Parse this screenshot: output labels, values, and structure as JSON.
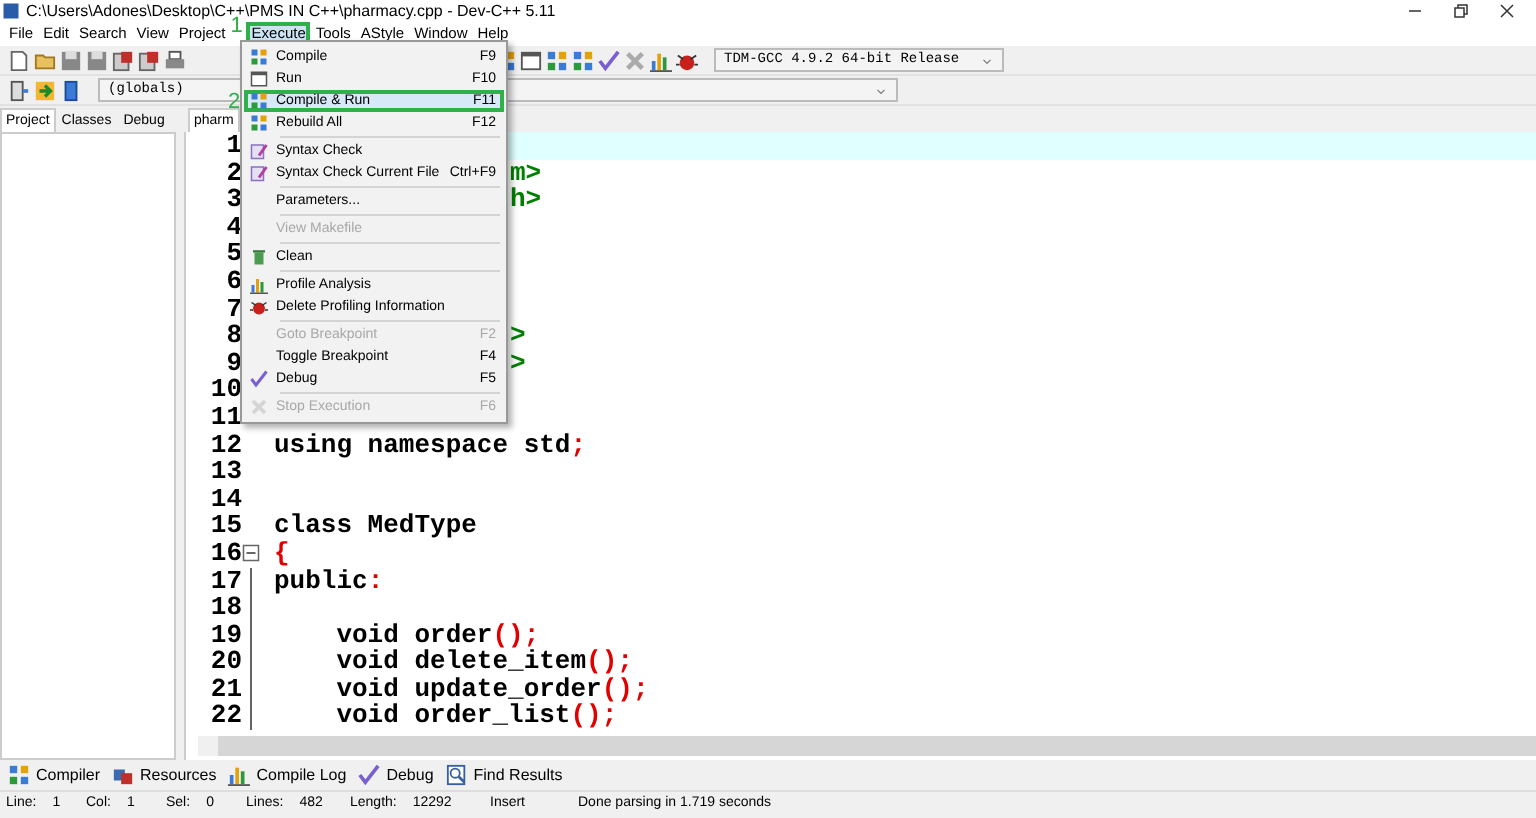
{
  "window": {
    "title": "C:\\Users\\Adones\\Desktop\\C++\\PMS IN C++\\pharmacy.cpp - Dev-C++ 5.11"
  },
  "menu_bar": [
    {
      "label": "File",
      "selected": false,
      "annotated": false
    },
    {
      "label": "Edit",
      "selected": false,
      "annotated": false
    },
    {
      "label": "Search",
      "selected": false,
      "annotated": false
    },
    {
      "label": "View",
      "selected": false,
      "annotated": false
    },
    {
      "label": "Project",
      "selected": false,
      "annotated": false
    },
    {
      "label": "Execute",
      "selected": true,
      "annotated": true
    },
    {
      "label": "Tools",
      "selected": false,
      "annotated": false
    },
    {
      "label": "AStyle",
      "selected": false,
      "annotated": false
    },
    {
      "label": "Window",
      "selected": false,
      "annotated": false
    },
    {
      "label": "Help",
      "selected": false,
      "annotated": false
    }
  ],
  "annotations": [
    {
      "label": "1"
    },
    {
      "label": "2"
    }
  ],
  "toolbar": {
    "compiler_select": {
      "value": "TDM-GCC 4.9.2 64-bit Release"
    },
    "scope_select": {
      "value": "(globals)"
    }
  },
  "execute_menu": [
    {
      "kind": "item",
      "label": "Compile",
      "shortcut": "F9",
      "disabled": false,
      "selected": false,
      "annotated": false
    },
    {
      "kind": "item",
      "label": "Run",
      "shortcut": "F10",
      "disabled": false,
      "selected": false,
      "annotated": false
    },
    {
      "kind": "item",
      "label": "Compile & Run",
      "shortcut": "F11",
      "disabled": false,
      "selected": true,
      "annotated": true
    },
    {
      "kind": "item",
      "label": "Rebuild All",
      "shortcut": "F12",
      "disabled": false,
      "selected": false,
      "annotated": false
    },
    {
      "kind": "separator"
    },
    {
      "kind": "item",
      "label": "Syntax Check",
      "disabled": false,
      "selected": false,
      "annotated": false
    },
    {
      "kind": "item",
      "label": "Syntax Check Current File",
      "shortcut": "Ctrl+F9",
      "disabled": false,
      "selected": false,
      "annotated": false
    },
    {
      "kind": "separator"
    },
    {
      "kind": "item",
      "label": "Parameters...",
      "disabled": false,
      "selected": false,
      "annotated": false
    },
    {
      "kind": "separator"
    },
    {
      "kind": "item",
      "label": "View Makefile",
      "disabled": true,
      "selected": false,
      "annotated": false
    },
    {
      "kind": "separator"
    },
    {
      "kind": "item",
      "label": "Clean",
      "disabled": false,
      "selected": false,
      "annotated": false
    },
    {
      "kind": "separator"
    },
    {
      "kind": "item",
      "label": "Profile Analysis",
      "disabled": false,
      "selected": false,
      "annotated": false
    },
    {
      "kind": "item",
      "label": "Delete Profiling Information",
      "disabled": false,
      "selected": false,
      "annotated": false
    },
    {
      "kind": "separator"
    },
    {
      "kind": "item",
      "label": "Goto Breakpoint",
      "shortcut": "F2",
      "disabled": true,
      "selected": false,
      "annotated": false
    },
    {
      "kind": "item",
      "label": "Toggle Breakpoint",
      "shortcut": "F4",
      "disabled": false,
      "selected": false,
      "annotated": false
    },
    {
      "kind": "item",
      "label": "Debug",
      "shortcut": "F5",
      "disabled": false,
      "selected": false,
      "annotated": false
    },
    {
      "kind": "separator"
    },
    {
      "kind": "item",
      "label": "Stop Execution",
      "shortcut": "F6",
      "disabled": true,
      "selected": false,
      "annotated": false
    }
  ],
  "side_tabs": [
    {
      "label": "Project",
      "selected": true
    },
    {
      "label": "Classes",
      "selected": false
    },
    {
      "label": "Debug",
      "selected": false
    }
  ],
  "editor_tabs": [
    {
      "label": "pharm",
      "selected": true
    }
  ],
  "code_lines": [
    {
      "number": "1",
      "current": true
    },
    {
      "number": "2",
      "text": "m>",
      "current": false
    },
    {
      "number": "3",
      "text": "h>",
      "current": false
    },
    {
      "number": "4",
      "current": false
    },
    {
      "number": "5",
      "current": false
    },
    {
      "number": "6",
      "current": false
    },
    {
      "number": "7",
      "current": false
    },
    {
      "number": "8",
      "text": ">",
      "current": false
    },
    {
      "number": "9",
      "text": ">",
      "current": false
    },
    {
      "number": "10",
      "current": false
    },
    {
      "number": "11",
      "current": false
    },
    {
      "number": "12",
      "text": "using namespace std;",
      "current": false,
      "fold": false
    },
    {
      "number": "13",
      "current": false,
      "fold": false
    },
    {
      "number": "14",
      "current": false,
      "fold": false
    },
    {
      "number": "15",
      "text": "class MedType",
      "current": false,
      "fold": false
    },
    {
      "number": "16",
      "text": "{",
      "current": false,
      "fold": true
    },
    {
      "number": "17",
      "text": "public:",
      "current": false,
      "fold": false
    },
    {
      "number": "18",
      "current": false,
      "fold": false
    },
    {
      "number": "19",
      "text": "    void order();",
      "current": false,
      "fold": false
    },
    {
      "number": "20",
      "text": "    void delete_item();",
      "current": false,
      "fold": false
    },
    {
      "number": "21",
      "text": "    void update_order();",
      "current": false,
      "fold": false
    },
    {
      "number": "22",
      "text": "    void order_list();",
      "current": false,
      "fold": false
    }
  ],
  "bottom_tabs": [
    {
      "label": "Compiler"
    },
    {
      "label": "Resources"
    },
    {
      "label": "Compile Log"
    },
    {
      "label": "Debug"
    },
    {
      "label": "Find Results"
    }
  ],
  "status_bar": [
    {
      "label": "Line:",
      "value": "1"
    },
    {
      "label": "Col:",
      "value": "1"
    },
    {
      "label": "Sel:",
      "value": "0"
    },
    {
      "label": "Lines:",
      "value": "482"
    },
    {
      "label": "Length:",
      "value": "12292"
    },
    {
      "value": "Insert"
    },
    {
      "value": "Done parsing in 1.719 seconds"
    }
  ]
}
